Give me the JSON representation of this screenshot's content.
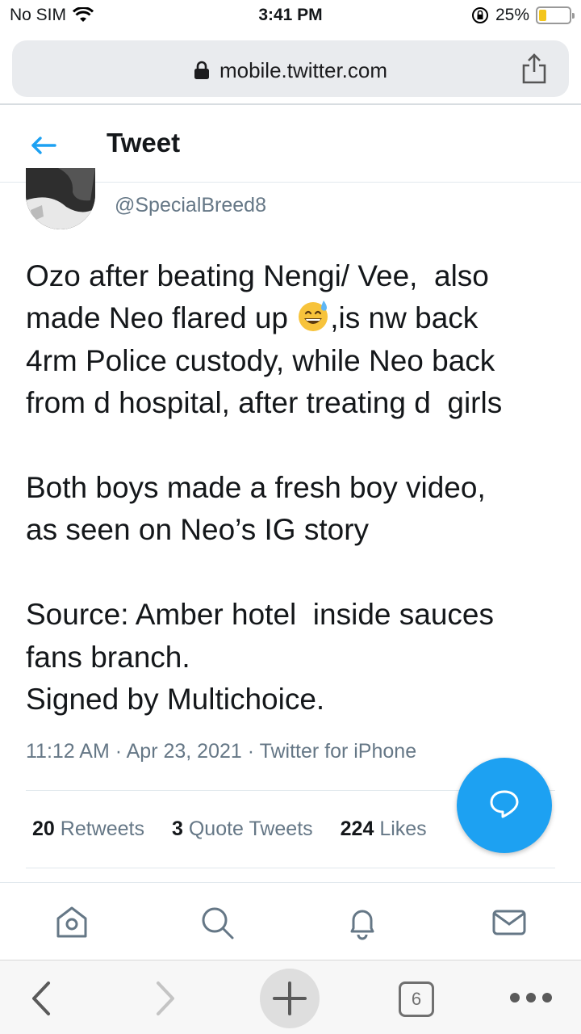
{
  "status_bar": {
    "carrier": "No SIM",
    "time": "3:41 PM",
    "battery_percent": "25%",
    "battery_level": 0.25,
    "battery_color": "#f3c51c"
  },
  "browser": {
    "url": "mobile.twitter.com",
    "open_tabs": "6"
  },
  "header": {
    "title": "Tweet"
  },
  "tweet": {
    "handle": "@SpecialBreed8",
    "text_line1": "Ozo after beating Nengi/ Vee,  also",
    "text_line2a": "made Neo flared up ",
    "emoji": "grinning-face-with-sweat",
    "text_line2b": ",is nw back",
    "text_rest": "4rm Police custody, while Neo back\nfrom d hospital, after treating d  girls\n\nBoth boys made a fresh boy video,\nas seen on Neo’s IG story\n\nSource: Amber hotel  inside sauces\nfans branch.\nSigned by Multichoice.",
    "time": "11:12 AM",
    "date": "Apr 23, 2021",
    "source": "Twitter for iPhone",
    "separator": " · "
  },
  "stats": {
    "retweets_count": "20",
    "retweets_label": "Retweets",
    "quotes_count": "3",
    "quotes_label": "Quote Tweets",
    "likes_count": "224",
    "likes_label": "Likes"
  },
  "nav_tabs": [
    "home-icon",
    "search-icon",
    "notifications-icon",
    "messages-icon"
  ],
  "colors": {
    "accent": "#1da1f2",
    "secondary_text": "#657786",
    "primary_text": "#14171a"
  }
}
